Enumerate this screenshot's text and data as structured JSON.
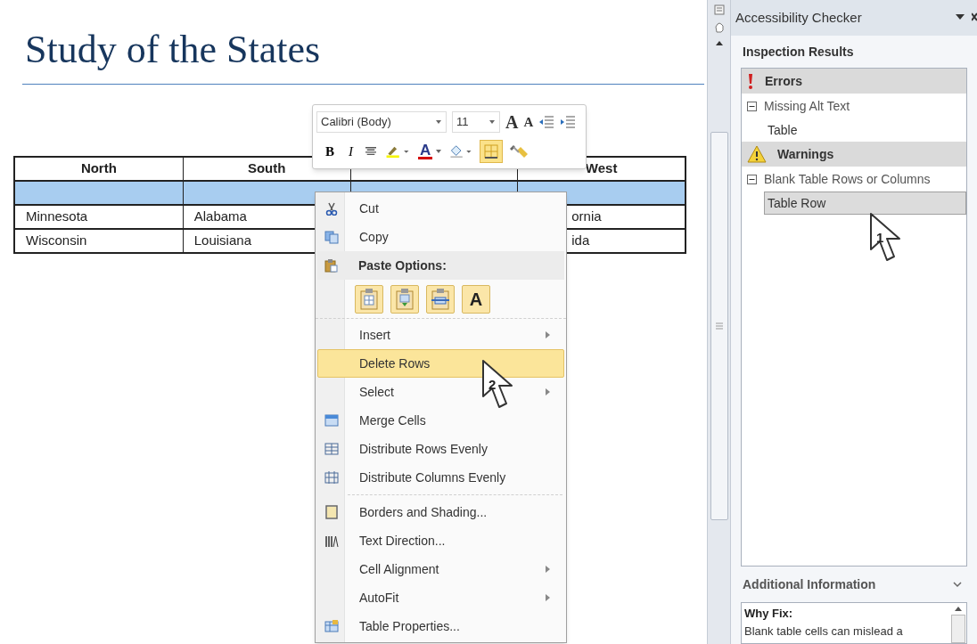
{
  "document": {
    "title": "Study of the States",
    "table": {
      "columns": [
        "North",
        "South",
        null,
        "West"
      ],
      "rows": [
        {
          "selected": true,
          "cells": [
            null,
            null,
            null,
            null
          ]
        },
        {
          "selected": false,
          "cells": [
            "Minnesota",
            "Alabama",
            null,
            "ornia"
          ]
        },
        {
          "selected": false,
          "cells": [
            "Wisconsin",
            "Louisiana",
            null,
            "ida"
          ]
        }
      ]
    }
  },
  "mini_toolbar": {
    "font": "Calibri (Body)",
    "size": "11",
    "row_1": [
      {
        "kind": "grow",
        "glyph": "A"
      },
      {
        "kind": "shrink",
        "glyph": "A"
      },
      {
        "kind": "outdent"
      },
      {
        "kind": "indent"
      }
    ],
    "row_2": [
      {
        "kind": "bold",
        "glyph": "B",
        "selected": false
      },
      {
        "kind": "italic",
        "glyph": "I",
        "selected": false
      },
      {
        "kind": "center",
        "selected": false
      },
      {
        "kind": "highlight",
        "selected": false
      },
      {
        "kind": "font_color",
        "glyph": "A",
        "selected": false
      },
      {
        "kind": "shading",
        "selected": false
      },
      {
        "kind": "borders",
        "selected": true
      },
      {
        "kind": "painter",
        "selected": false
      }
    ]
  },
  "context_menu": [
    {
      "kind": "item",
      "label": "Cut",
      "selected": false,
      "submenu": false
    },
    {
      "kind": "item",
      "label": "Copy",
      "selected": false,
      "submenu": false
    },
    {
      "kind": "header",
      "label": "Paste Options:"
    },
    {
      "kind": "paste",
      "buttons": [
        {
          "kind": "icon"
        },
        {
          "kind": "icon"
        },
        {
          "kind": "icon"
        },
        {
          "kind": "glyph",
          "glyph": "A"
        }
      ]
    },
    {
      "kind": "item",
      "label": "Insert",
      "selected": false,
      "submenu": true
    },
    {
      "kind": "item",
      "label": "Delete Rows",
      "selected": true,
      "submenu": false
    },
    {
      "kind": "item",
      "label": "Select",
      "selected": false,
      "submenu": true
    },
    {
      "kind": "item",
      "label": "Merge Cells",
      "selected": false,
      "submenu": false
    },
    {
      "kind": "item",
      "label": "Distribute Rows Evenly",
      "selected": false,
      "submenu": false
    },
    {
      "kind": "item",
      "label": "Distribute Columns Evenly",
      "selected": false,
      "submenu": false
    },
    {
      "kind": "separator"
    },
    {
      "kind": "item",
      "label": "Borders and Shading...",
      "selected": false,
      "submenu": false
    },
    {
      "kind": "item",
      "label": "Text Direction...",
      "selected": false,
      "submenu": false
    },
    {
      "kind": "item",
      "label": "Cell Alignment",
      "selected": false,
      "submenu": true
    },
    {
      "kind": "item",
      "label": "AutoFit",
      "selected": false,
      "submenu": true
    },
    {
      "kind": "item",
      "label": "Table Properties...",
      "selected": false,
      "submenu": false
    }
  ],
  "cursors": [
    {
      "number": "1"
    },
    {
      "number": "2"
    }
  ],
  "task_pane": {
    "title": "Accessibility Checker",
    "heading": "Inspection Results",
    "groups": [
      {
        "kind": "error",
        "label": "Errors",
        "issues": [
          {
            "label": "Missing Alt Text",
            "expanded": true,
            "children": [
              {
                "label": "Table",
                "selected": false
              }
            ]
          }
        ]
      },
      {
        "kind": "warning",
        "label": "Warnings",
        "issues": [
          {
            "label": "Blank Table Rows or Columns",
            "expanded": true,
            "children": [
              {
                "label": "Table Row",
                "selected": true
              }
            ]
          }
        ]
      }
    ],
    "additional_heading": "Additional Information",
    "why_title": "Why Fix:",
    "why_text": "Blank table cells can mislead a"
  }
}
